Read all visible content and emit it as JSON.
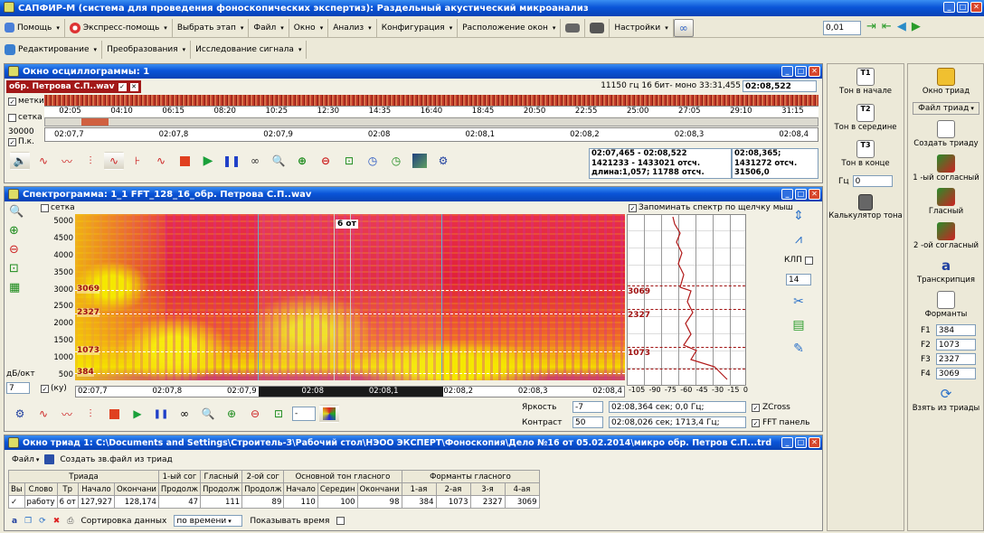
{
  "app": {
    "title": "САПФИР-М (система для проведения фоноскопических экспертиз): Раздельный акустический микроанализ"
  },
  "menubar": {
    "items": [
      "Помощь",
      "Экспресс-помощь",
      "Выбрать этап",
      "Файл",
      "Окно",
      "Анализ",
      "Конфигурация",
      "Расположение окон",
      "Настройки"
    ],
    "value": "0,01"
  },
  "menubar2": {
    "items": [
      "Редактирование",
      "Преобразования",
      "Исследование сигнала"
    ]
  },
  "osc": {
    "title": "Окно осциллограммы: 1",
    "file": "обр. Петрова С.П..wav",
    "info": "11150 гц 16 бит- моно 33:31,455",
    "time": "02:08,522",
    "label_marks": "метки",
    "label_grid": "сетка",
    "label_pk": "П.к.",
    "yval": "30000",
    "timeline_top": [
      "02:05",
      "04:10",
      "06:15",
      "08:20",
      "10:25",
      "12:30",
      "14:35",
      "16:40",
      "18:45",
      "20:50",
      "22:55",
      "25:00",
      "27:05",
      "29:10",
      "31:15"
    ],
    "timeline_bottom": [
      "02:07,7",
      "02:07,8",
      "02:07,9",
      "02:08",
      "02:08,1",
      "02:08,2",
      "02:08,3",
      "02:08,4"
    ],
    "sel1": "02:07,465 - 02:08,522",
    "sel2": "1421233 - 1433021 отсч.",
    "sel3": "длина:1,057; 11788 отсч.",
    "cur1": "02:08,365;",
    "cur2": "1431272 отсч.",
    "cur3": "31506,0"
  },
  "spec": {
    "title": "Спектрограмма: 1_1  FFT_128_16_обр. Петрова С.П..wav",
    "label_grid": "сетка",
    "yticks": [
      "5000",
      "4500",
      "4000",
      "3500",
      "3000",
      "2500",
      "2000",
      "1500",
      "1000",
      "500"
    ],
    "formants": [
      "3069",
      "2327",
      "1073",
      "384"
    ],
    "mark": "6 от",
    "xticks": [
      "02:07,7",
      "02:07,8",
      "02:07,9",
      "02:08",
      "02:08,1",
      "02:08,2",
      "02:08,3",
      "02:08,4"
    ],
    "db_label": "дБ/окт",
    "db_val": "7",
    "ku": "(ку)",
    "remember": "Запоминать спектр по щелчку мыш",
    "klp": "КЛП",
    "klp_val": "14",
    "spec_xticks": [
      "-105",
      "-90",
      "-75",
      "-60",
      "-45",
      "-30",
      "-15",
      "0"
    ],
    "brightness_label": "Яркость",
    "brightness": "-7",
    "contrast_label": "Контраст",
    "contrast": "50",
    "readout1": "02:08,364 сек; 0,0 Гц;",
    "readout2": "02:08,026 сек; 1713,4 Гц;",
    "zcross": "ZCross",
    "fft": "FFT панель",
    "select": "-"
  },
  "triad": {
    "title": "Окно триад 1: C:\\Documents and Settings\\Строитель-3\\Рабочий стол\\НЭОО ЭКСПЕРТ\\Фоноскопия\\Дело №16 от 05.02.2014\\микро обр. Петров С.П...trd",
    "file_menu": "Файл",
    "create": "Создать зв.файл из триад",
    "group_headers": [
      "Триада",
      "1-ый сог",
      "Гласный",
      "2-ой сог",
      "Основной тон гласного",
      "Форманты гласного"
    ],
    "col_headers": [
      "Вы",
      "Слово",
      "Тр",
      "Начало",
      "Окончани",
      "Продолж",
      "Продолж",
      "Продолж",
      "Начало",
      "Середин",
      "Окончани",
      "1-ая",
      "2-ая",
      "3-я",
      "4-ая"
    ],
    "row": [
      "работу",
      "6 от",
      "127,927",
      "128,174",
      "47",
      "111",
      "89",
      "110",
      "100",
      "98",
      "384",
      "1073",
      "2327",
      "3069"
    ],
    "sort_label": "Сортировка данных",
    "sort_value": "по времени",
    "show_time": "Показывать время"
  },
  "right1": {
    "tools": [
      "Тон в начале",
      "Тон в середине",
      "Тон в конце"
    ],
    "hz_label": "Гц",
    "hz_val": "0",
    "calc": "Калькулятор тона"
  },
  "right2": {
    "window": "Окно триад",
    "file": "Файл триад",
    "create": "Создать триаду",
    "c1": "1 -ый согласный",
    "vowel": "Гласный",
    "c2": "2 -ой согласный",
    "trans": "Транскрипция",
    "formants_label": "Форманты",
    "formants": [
      {
        "k": "F1",
        "v": "384"
      },
      {
        "k": "F2",
        "v": "1073"
      },
      {
        "k": "F3",
        "v": "2327"
      },
      {
        "k": "F4",
        "v": "3069"
      }
    ],
    "take": "Взять из триады"
  },
  "colors": {
    "title_blue": "#0a55d8",
    "spec_yellow": "#f5e800",
    "spec_red": "#e0203a",
    "spec_magenta": "#d2309a",
    "formant_red": "#a01010"
  }
}
